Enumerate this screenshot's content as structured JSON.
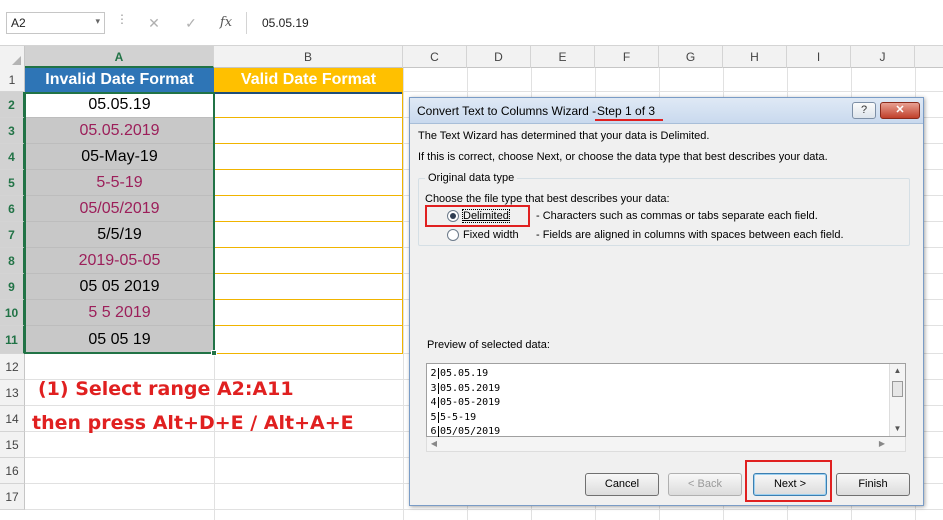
{
  "formula_bar": {
    "name_box": "A2",
    "name_box_arrow": "▾",
    "dots": "⋮",
    "cancel_icon": "✕",
    "enter_icon": "✓",
    "fx_label": "fx",
    "content": "05.05.19"
  },
  "columns": [
    "A",
    "B",
    "C",
    "D",
    "E",
    "F",
    "G",
    "H",
    "I",
    "J"
  ],
  "rows": [
    "1",
    "2",
    "3",
    "4",
    "5",
    "6",
    "7",
    "8",
    "9",
    "10",
    "11",
    "12",
    "13",
    "14",
    "15",
    "16",
    "17"
  ],
  "sheet": {
    "header_a": "Invalid Date Format",
    "header_b": "Valid Date Format",
    "cells_a": [
      {
        "text": "05.05.19",
        "color": "#000000",
        "bg": "#ffffff"
      },
      {
        "text": "05.05.2019",
        "color": "#9c1f5a",
        "bg": "#c8c8c8"
      },
      {
        "text": "05-May-19",
        "color": "#000000",
        "bg": "#c8c8c8"
      },
      {
        "text": "5-5-19",
        "color": "#9c1f5a",
        "bg": "#c8c8c8"
      },
      {
        "text": "05/05/2019",
        "color": "#9c1f5a",
        "bg": "#c8c8c8"
      },
      {
        "text": "5/5/19",
        "color": "#000000",
        "bg": "#c8c8c8"
      },
      {
        "text": "2019-05-05",
        "color": "#9c1f5a",
        "bg": "#c8c8c8"
      },
      {
        "text": "05 05 2019",
        "color": "#000000",
        "bg": "#c8c8c8"
      },
      {
        "text": "5 5 2019",
        "color": "#9c1f5a",
        "bg": "#c8c8c8"
      },
      {
        "text": "05 05 19",
        "color": "#000000",
        "bg": "#c8c8c8"
      }
    ]
  },
  "annotation": {
    "line1": "(1) Select range A2:A11",
    "line2": "then press Alt+D+E / Alt+A+E"
  },
  "dialog": {
    "title": "Convert Text to Columns Wizard - ",
    "step": "Step 1 of 3",
    "help_label": "?",
    "close_label": "✕",
    "line1": "The Text Wizard has determined that your data is Delimited.",
    "line2": "If this is correct, choose Next, or choose the data type that best describes your data.",
    "group_title": "Original data type",
    "choose_label": "Choose the file type that best describes your data:",
    "options": [
      {
        "label": "Delimited",
        "desc": "- Characters such as commas or tabs separate each field.",
        "selected": true
      },
      {
        "label": "Fixed width",
        "desc": "- Fields are aligned in columns with spaces between each field.",
        "selected": false
      }
    ],
    "preview_label": "Preview of selected data:",
    "preview_rows": [
      {
        "num": "2",
        "text": "05.05.19"
      },
      {
        "num": "3",
        "text": "05.05.2019"
      },
      {
        "num": "4",
        "text": "05-05-2019"
      },
      {
        "num": "5",
        "text": "5-5-19"
      },
      {
        "num": "6",
        "text": "05/05/2019"
      }
    ],
    "buttons": {
      "cancel": "Cancel",
      "back": "< Back",
      "next": "Next >",
      "finish": "Finish"
    }
  }
}
